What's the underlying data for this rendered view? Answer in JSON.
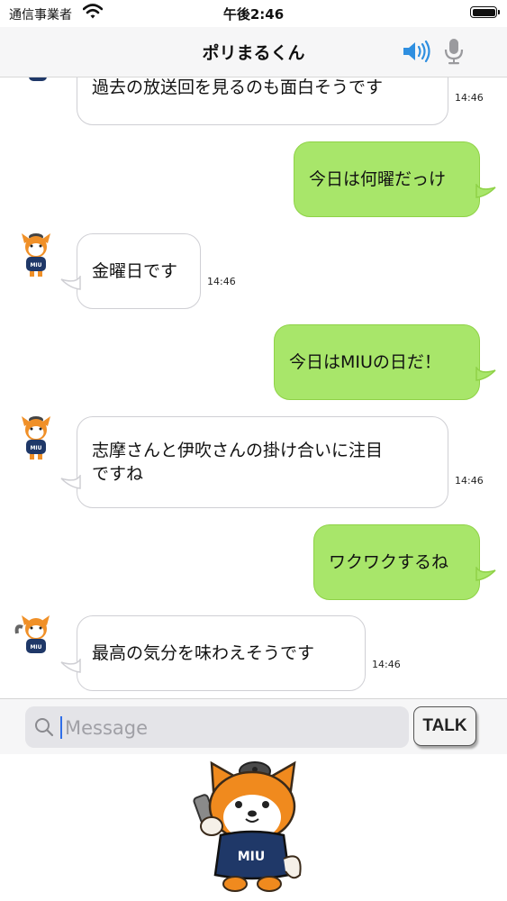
{
  "status_bar": {
    "carrier": "通信事業者",
    "time": "午後2:46"
  },
  "nav": {
    "title": "ポリまるくん",
    "speaker_icon": "speaker-icon",
    "mic_icon": "microphone-icon"
  },
  "colors": {
    "incoming_bubble": "#ffffff",
    "outgoing_bubble": "#a8e66a",
    "outgoing_border": "#8fd247",
    "caret": "#2f6ee8"
  },
  "messages": [
    {
      "from": "bot",
      "lines": [
        "過去の放送回を見るのも面白そうです"
      ],
      "time": "14:46"
    },
    {
      "from": "user",
      "lines": [
        "今日は何曜だっけ"
      ]
    },
    {
      "from": "bot",
      "lines": [
        "金曜日です"
      ],
      "time": "14:46"
    },
    {
      "from": "user",
      "lines": [
        "今日はMIUの日だ！"
      ]
    },
    {
      "from": "bot",
      "lines": [
        "志摩さんと伊吹さんの掛け合いに注目",
        "ですね"
      ],
      "time": "14:46"
    },
    {
      "from": "user",
      "lines": [
        "ワクワクするね"
      ]
    },
    {
      "from": "bot",
      "lines": [
        "最高の気分を味わえそうです"
      ],
      "time": "14:46"
    }
  ],
  "avatar_shirt_text": "MIU",
  "input": {
    "placeholder": "Message",
    "value": "",
    "search_icon": "search-icon"
  },
  "talk_button": {
    "label": "TALK"
  }
}
